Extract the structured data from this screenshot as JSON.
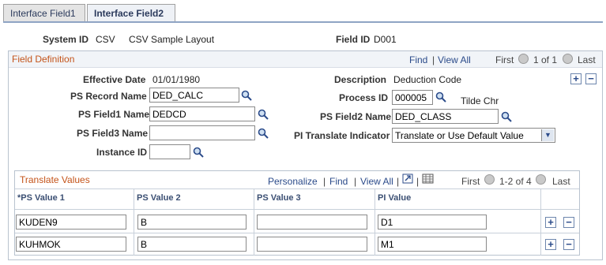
{
  "tabs": [
    {
      "label": "Interface Field1",
      "active": false
    },
    {
      "label": "Interface Field2",
      "active": true
    }
  ],
  "header": {
    "system_id_label": "System ID",
    "system_id_value": "CSV",
    "system_desc": "CSV Sample Layout",
    "field_id_label": "Field ID",
    "field_id_value": "D001"
  },
  "field_definition": {
    "title": "Field Definition",
    "nav": {
      "find": "Find",
      "sep": "|",
      "view_all": "View All",
      "first": "First",
      "range": "1 of 1",
      "last": "Last"
    },
    "effective_date_label": "Effective Date",
    "effective_date_value": "01/01/1980",
    "description_label": "Description",
    "description_value": "Deduction Code",
    "ps_record_label": "PS Record Name",
    "ps_record_value": "DED_CALC",
    "process_id_label": "Process ID",
    "process_id_value": "000005",
    "process_id_desc": "Tilde Chr",
    "ps_field1_label": "PS Field1 Name",
    "ps_field1_value": "DEDCD",
    "ps_field2_label": "PS Field2 Name",
    "ps_field2_value": "DED_CLASS",
    "ps_field3_label": "PS Field3 Name",
    "ps_field3_value": "",
    "pi_translate_label": "PI Translate Indicator",
    "pi_translate_value": "Translate or Use Default Value",
    "instance_id_label": "Instance ID",
    "instance_id_value": ""
  },
  "translate_values": {
    "title": "Translate Values",
    "nav": {
      "personalize": "Personalize",
      "find": "Find",
      "view_all": "View All",
      "first": "First",
      "range": "1-2 of 4",
      "last": "Last"
    },
    "columns": [
      "*PS Value 1",
      "PS Value 2",
      "PS Value 3",
      "PI Value"
    ],
    "rows": [
      {
        "v1": "KUDEN9",
        "v2": "B",
        "v3": "",
        "pi": "D1"
      },
      {
        "v1": "KUHMOK",
        "v2": "B",
        "v3": "",
        "pi": "M1"
      }
    ]
  },
  "icons": {
    "lookup": "magnifier-icon",
    "add": "plus-icon",
    "delete": "minus-icon",
    "prev": "prev-arrow-icon",
    "next": "next-arrow-icon",
    "zoom": "zoom-icon",
    "download": "download-grid-icon"
  },
  "colors": {
    "section_title": "#c4541a",
    "link": "#2b4b8a",
    "border": "#b9c3cf"
  }
}
